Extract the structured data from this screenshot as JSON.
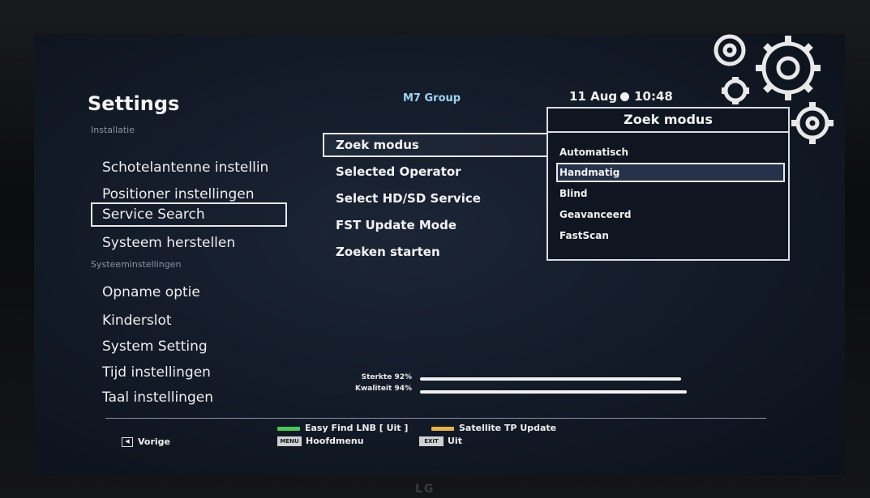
{
  "header": {
    "title": "Settings",
    "operator": "M7 Group",
    "date": "11 Aug",
    "time": "10:48"
  },
  "sidebar": {
    "section_installatie": "Installatie",
    "section_systeem": "Systeeminstellingen",
    "items": [
      {
        "label": "Schotelantenne instellin"
      },
      {
        "label": "Positioner instellingen"
      },
      {
        "label": "Service Search",
        "selected": true
      },
      {
        "label": "Systeem herstellen"
      },
      {
        "label": "Opname optie"
      },
      {
        "label": "Kinderslot"
      },
      {
        "label": "System Setting"
      },
      {
        "label": "Tijd instellingen"
      },
      {
        "label": "Taal instellingen"
      }
    ]
  },
  "options": {
    "items": [
      {
        "label": "Zoek modus",
        "selected": true
      },
      {
        "label": "Selected Operator"
      },
      {
        "label": "Select HD/SD Service"
      },
      {
        "label": "FST Update Mode"
      },
      {
        "label": "Zoeken starten"
      }
    ]
  },
  "popup": {
    "title": "Zoek modus",
    "items": [
      {
        "label": "Automatisch"
      },
      {
        "label": "Handmatig",
        "selected": true
      },
      {
        "label": "Blind"
      },
      {
        "label": "Geavanceerd"
      },
      {
        "label": "FastScan"
      }
    ]
  },
  "signal": {
    "strength_label": "Sterkte 92%",
    "strength_value": 0.92,
    "quality_label": "Kwaliteit 94%",
    "quality_value": 0.94
  },
  "footer": {
    "back_label": "Vorige",
    "green_label": "Easy Find LNB [ Uit ]",
    "yellow_label": "Satellite TP Update",
    "menu_key": "MENU",
    "menu_label": "Hoofdmenu",
    "exit_key": "EXIT",
    "exit_label": "Uit",
    "green_color": "#49c85a",
    "yellow_color": "#e6b24a"
  },
  "tv_brand": "LG"
}
